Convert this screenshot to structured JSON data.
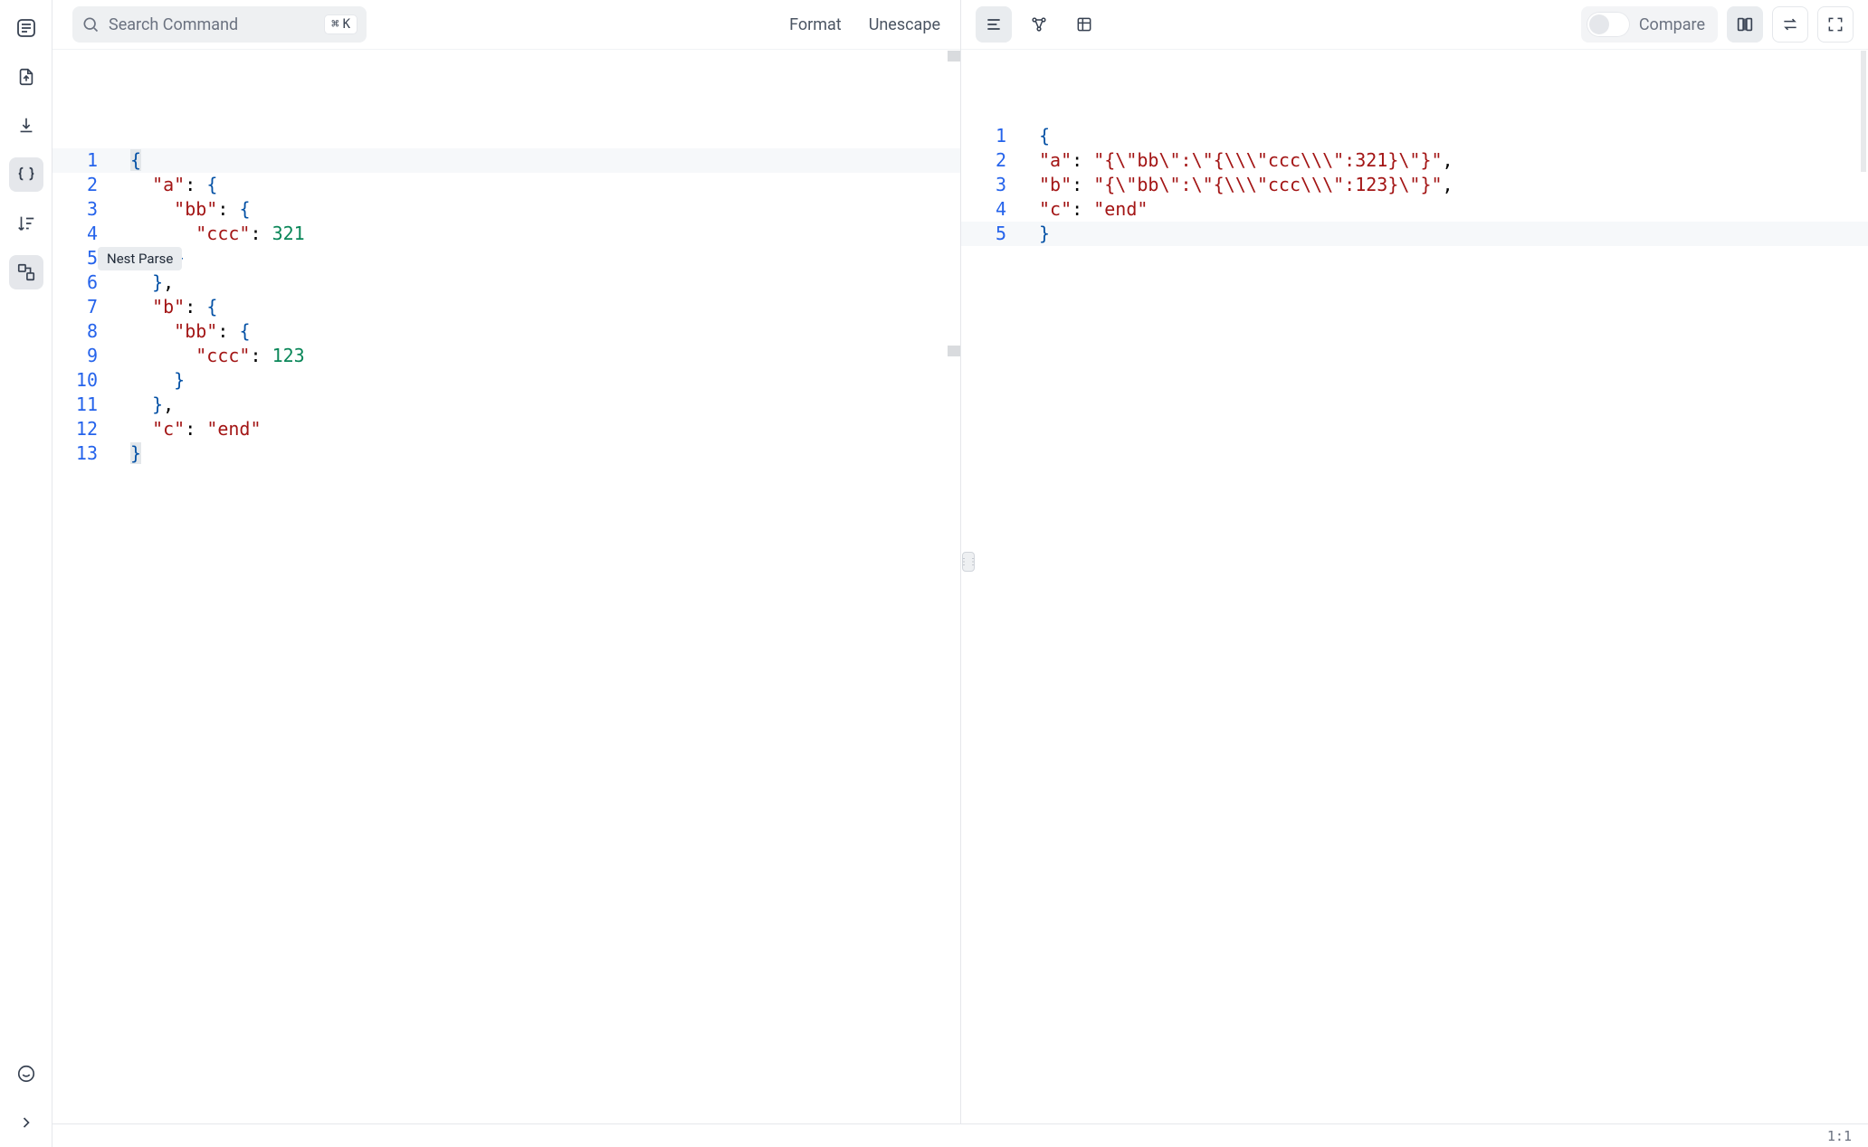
{
  "search": {
    "placeholder": "Search Command",
    "shortcut_mod": "⌘",
    "shortcut_key": "K"
  },
  "topmenu": {
    "format": "Format",
    "unescape": "Unescape"
  },
  "sidebar": {
    "icons": {
      "app": "app-logo-icon",
      "import": "file-import-icon",
      "export": "download-icon",
      "braces": "braces-icon",
      "sort": "sort-icon",
      "nestparse": "nest-parse-icon",
      "feedback": "chat-icon",
      "expand": "chevron-right-icon"
    },
    "tooltip": "Nest Parse"
  },
  "right_toolbar": {
    "compare_label": "Compare",
    "icons": {
      "list": "list-icon",
      "graph": "graph-icon",
      "table": "table-icon",
      "compare_columns": "columns-icon",
      "swap": "swap-icon",
      "fullscreen": "fullscreen-icon"
    }
  },
  "editor_left": {
    "lines": [
      {
        "n": "1",
        "segs": [
          {
            "c": "tok-brace bracket-match",
            "t": "{"
          }
        ]
      },
      {
        "n": "2",
        "segs": [
          {
            "c": "",
            "t": "  "
          },
          {
            "c": "tok-key",
            "t": "\"a\""
          },
          {
            "c": "tok-punc",
            "t": ": "
          },
          {
            "c": "tok-brace",
            "t": "{"
          }
        ]
      },
      {
        "n": "3",
        "segs": [
          {
            "c": "",
            "t": "    "
          },
          {
            "c": "tok-key",
            "t": "\"bb\""
          },
          {
            "c": "tok-punc",
            "t": ": "
          },
          {
            "c": "tok-brace",
            "t": "{"
          }
        ]
      },
      {
        "n": "4",
        "segs": [
          {
            "c": "",
            "t": "      "
          },
          {
            "c": "tok-key",
            "t": "\"ccc\""
          },
          {
            "c": "tok-punc",
            "t": ": "
          },
          {
            "c": "tok-num",
            "t": "321"
          }
        ]
      },
      {
        "n": "5",
        "segs": [
          {
            "c": "",
            "t": "    "
          },
          {
            "c": "tok-brace",
            "t": "}"
          }
        ]
      },
      {
        "n": "6",
        "segs": [
          {
            "c": "",
            "t": "  "
          },
          {
            "c": "tok-brace",
            "t": "}"
          },
          {
            "c": "tok-punc",
            "t": ","
          }
        ]
      },
      {
        "n": "7",
        "segs": [
          {
            "c": "",
            "t": "  "
          },
          {
            "c": "tok-key",
            "t": "\"b\""
          },
          {
            "c": "tok-punc",
            "t": ": "
          },
          {
            "c": "tok-brace",
            "t": "{"
          }
        ]
      },
      {
        "n": "8",
        "segs": [
          {
            "c": "",
            "t": "    "
          },
          {
            "c": "tok-key",
            "t": "\"bb\""
          },
          {
            "c": "tok-punc",
            "t": ": "
          },
          {
            "c": "tok-brace",
            "t": "{"
          }
        ]
      },
      {
        "n": "9",
        "segs": [
          {
            "c": "",
            "t": "      "
          },
          {
            "c": "tok-key",
            "t": "\"ccc\""
          },
          {
            "c": "tok-punc",
            "t": ": "
          },
          {
            "c": "tok-num",
            "t": "123"
          }
        ]
      },
      {
        "n": "10",
        "segs": [
          {
            "c": "",
            "t": "    "
          },
          {
            "c": "tok-brace",
            "t": "}"
          }
        ]
      },
      {
        "n": "11",
        "segs": [
          {
            "c": "",
            "t": "  "
          },
          {
            "c": "tok-brace",
            "t": "}"
          },
          {
            "c": "tok-punc",
            "t": ","
          }
        ]
      },
      {
        "n": "12",
        "segs": [
          {
            "c": "",
            "t": "  "
          },
          {
            "c": "tok-key",
            "t": "\"c\""
          },
          {
            "c": "tok-punc",
            "t": ": "
          },
          {
            "c": "tok-str",
            "t": "\"end\""
          }
        ]
      },
      {
        "n": "13",
        "segs": [
          {
            "c": "tok-brace bracket-match",
            "t": "}"
          }
        ]
      }
    ],
    "highlight_row": 1
  },
  "editor_right": {
    "lines": [
      {
        "n": "1",
        "segs": [
          {
            "c": "tok-brace",
            "t": "{"
          }
        ]
      },
      {
        "n": "2",
        "segs": [
          {
            "c": "tok-key",
            "t": "\"a\""
          },
          {
            "c": "tok-punc",
            "t": ": "
          },
          {
            "c": "tok-str",
            "t": "\"{\\\"bb\\\":\\\"{\\\\\\\"ccc\\\\\\\":321}\\\"}\""
          },
          {
            "c": "tok-punc",
            "t": ","
          }
        ]
      },
      {
        "n": "3",
        "segs": [
          {
            "c": "tok-key",
            "t": "\"b\""
          },
          {
            "c": "tok-punc",
            "t": ": "
          },
          {
            "c": "tok-str",
            "t": "\"{\\\"bb\\\":\\\"{\\\\\\\"ccc\\\\\\\":123}\\\"}\""
          },
          {
            "c": "tok-punc",
            "t": ","
          }
        ]
      },
      {
        "n": "4",
        "segs": [
          {
            "c": "tok-key",
            "t": "\"c\""
          },
          {
            "c": "tok-punc",
            "t": ": "
          },
          {
            "c": "tok-str",
            "t": "\"end\""
          }
        ]
      },
      {
        "n": "5",
        "segs": [
          {
            "c": "tok-brace",
            "t": "}"
          }
        ]
      }
    ],
    "highlight_row": 5
  },
  "status": {
    "cursor": "1:1"
  }
}
